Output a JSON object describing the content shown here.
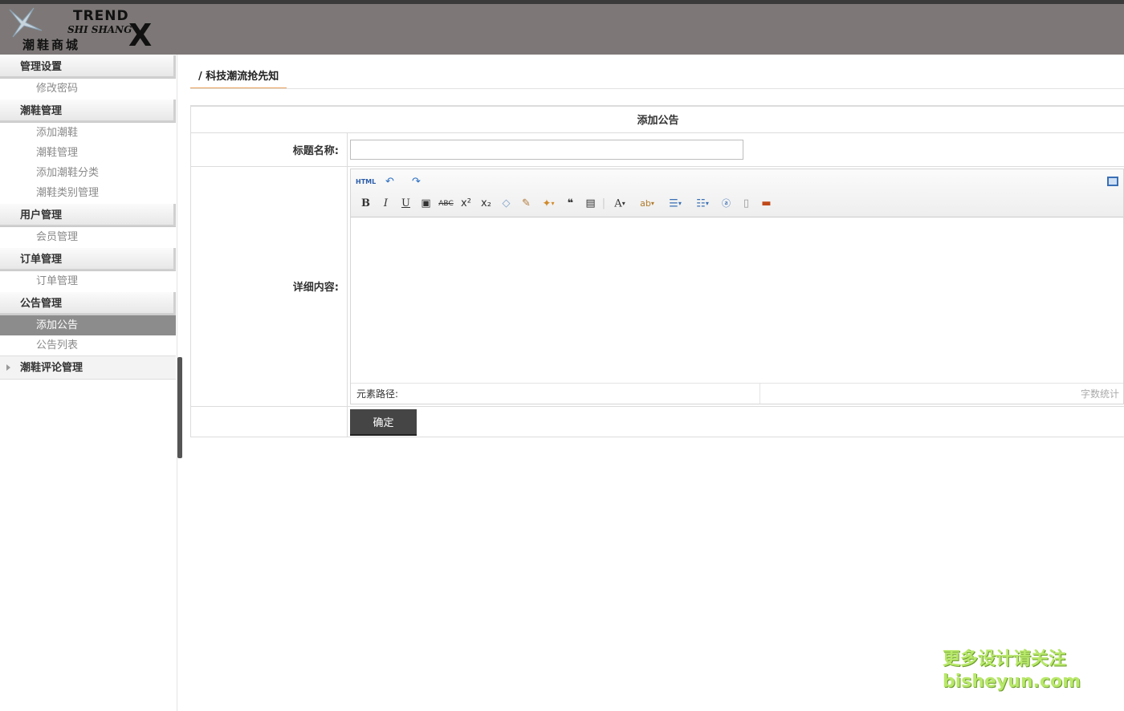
{
  "logo": {
    "line1": "TREND",
    "line2": "SHI SHANG",
    "line3": "潮鞋商城",
    "mark": "X"
  },
  "sidebar": {
    "groups": [
      {
        "label": "管理设置",
        "items": [
          "修改密码"
        ]
      },
      {
        "label": "潮鞋管理",
        "items": [
          "添加潮鞋",
          "潮鞋管理",
          "添加潮鞋分类",
          "潮鞋类别管理"
        ]
      },
      {
        "label": "用户管理",
        "items": [
          "会员管理"
        ]
      },
      {
        "label": "订单管理",
        "items": [
          "订单管理"
        ]
      },
      {
        "label": "公告管理",
        "items": [
          "添加公告",
          "公告列表"
        ]
      },
      {
        "label": "潮鞋评论管理",
        "items": []
      }
    ],
    "active_item": "添加公告"
  },
  "tab": {
    "label": "/ 科技潮流抢先知"
  },
  "form": {
    "header": "添加公告",
    "title_label": "标题名称:",
    "title_value": "",
    "content_label": "详细内容:",
    "submit_label": "确定"
  },
  "editor": {
    "html_label": "HTML",
    "bold": "B",
    "italic": "I",
    "underline": "U",
    "path_label": "元素路径:",
    "count_label": "字数统计"
  },
  "watermark": {
    "line1": "更多设计请关注",
    "line2": "bisheyun.com"
  }
}
